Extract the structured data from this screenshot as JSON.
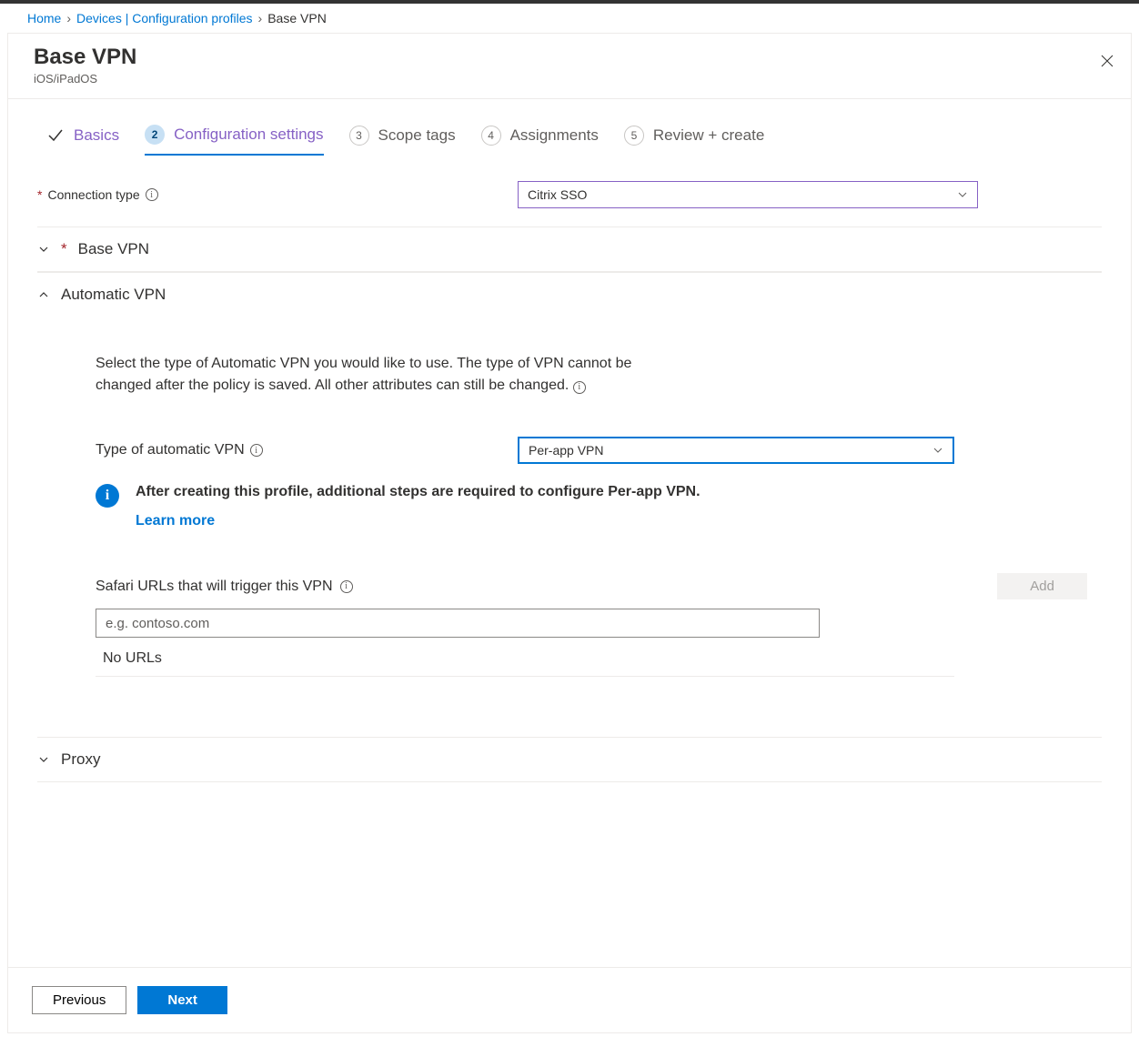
{
  "breadcrumb": {
    "home": "Home",
    "devices": "Devices | Configuration profiles",
    "current": "Base VPN"
  },
  "header": {
    "title": "Base VPN",
    "subtitle": "iOS/iPadOS"
  },
  "wizard": {
    "steps": [
      {
        "label": "Basics"
      },
      {
        "num": "2",
        "label": "Configuration settings"
      },
      {
        "num": "3",
        "label": "Scope tags"
      },
      {
        "num": "4",
        "label": "Assignments"
      },
      {
        "num": "5",
        "label": "Review + create"
      }
    ]
  },
  "form": {
    "connection_type_label": "Connection type",
    "connection_type_value": "Citrix SSO",
    "sections": {
      "base_vpn": "Base VPN",
      "automatic_vpn": "Automatic VPN",
      "proxy": "Proxy"
    },
    "auto_vpn": {
      "help": "Select the type of Automatic VPN you would like to use. The type of VPN cannot be changed after the policy is saved. All other attributes can still be changed.",
      "type_label": "Type of automatic VPN",
      "type_value": "Per-app VPN",
      "note": "After creating this profile, additional steps are required to configure Per-app VPN.",
      "learn_more": "Learn more",
      "safari_label": "Safari URLs that will trigger this VPN",
      "add_label": "Add",
      "url_placeholder": "e.g. contoso.com",
      "no_urls": "No URLs"
    }
  },
  "footer": {
    "previous": "Previous",
    "next": "Next"
  }
}
